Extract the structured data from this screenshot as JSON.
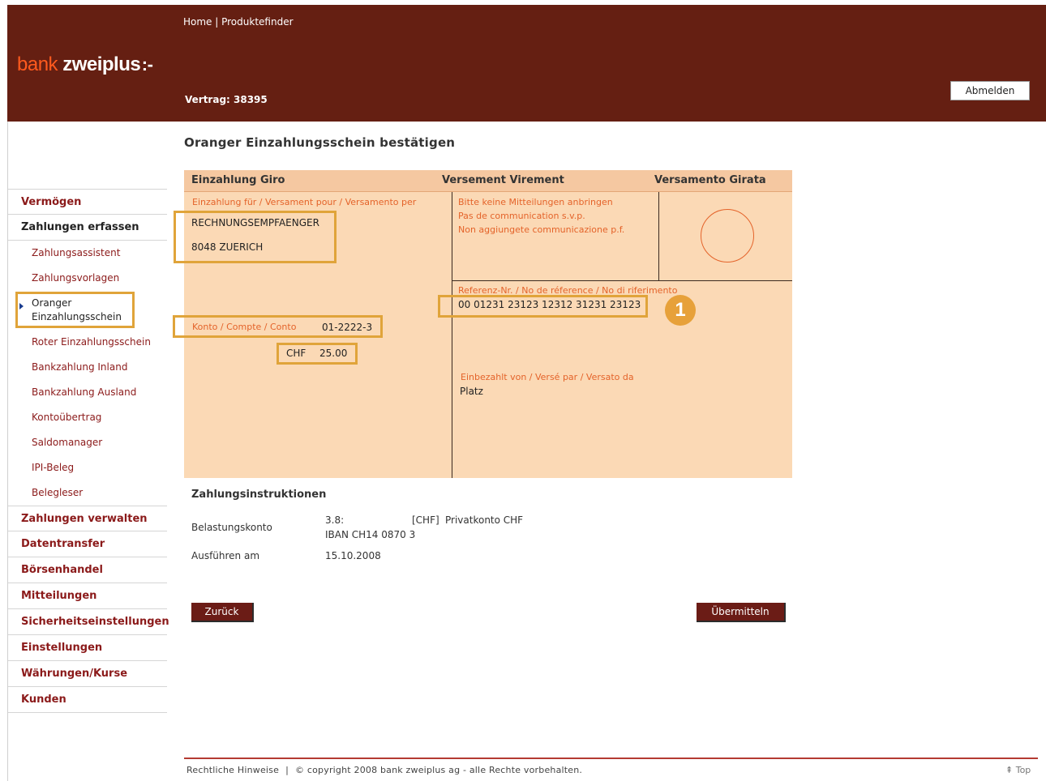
{
  "header": {
    "topnav_home": "Home",
    "topnav_sep": " | ",
    "topnav_finder": "Produktefinder",
    "logo_part1": "bank",
    "logo_part2": " zweiplus",
    "logo_mark": ":-",
    "contract": "Vertrag: 38395",
    "logout_label": "Abmelden"
  },
  "page_title": "Oranger Einzahlungsschein bestätigen",
  "sidebar": {
    "items": [
      {
        "label": "Vermögen"
      },
      {
        "label": "Zahlungen erfassen"
      },
      {
        "label": "Zahlungsassistent"
      },
      {
        "label": "Zahlungsvorlagen"
      },
      {
        "label_line1": "Oranger",
        "label_line2": "Einzahlungsschein"
      },
      {
        "label": "Roter Einzahlungsschein"
      },
      {
        "label": "Bankzahlung Inland"
      },
      {
        "label": "Bankzahlung Ausland"
      },
      {
        "label": "Kontoübertrag"
      },
      {
        "label": "Saldomanager"
      },
      {
        "label": "IPI-Beleg"
      },
      {
        "label": "Belegleser"
      },
      {
        "label": "Zahlungen verwalten"
      },
      {
        "label": "Datentransfer"
      },
      {
        "label": "Börsenhandel"
      },
      {
        "label": "Mitteilungen"
      },
      {
        "label": "Sicherheitseinstellungen"
      },
      {
        "label": "Einstellungen"
      },
      {
        "label": "Währungen/Kurse"
      },
      {
        "label": "Kunden"
      }
    ]
  },
  "slip": {
    "header_left": "Einzahlung Giro",
    "header_center": "Versement Virement",
    "header_right": "Versamento Girata",
    "for_label": "Einzahlung für / Versament pour / Versamento per",
    "recipient_name": "RECHNUNGSEMPFAENGER",
    "recipient_city": "8048 ZUERICH",
    "no_message_1": "Bitte keine Mitteilungen anbringen",
    "no_message_2": "Pas de communication s.v.p.",
    "no_message_3": "Non aggiungete communicazione p.f.",
    "reference_label": "Referenz-Nr. / No de réference / No di riferimento",
    "reference_value": "00 01231 23123 12312 31231 23123",
    "badge": "1",
    "account_label": "Konto / Compte / Conto",
    "account_value": "01-2222-3",
    "currency": "CHF",
    "amount": "25.00",
    "paid_by_label": "Einbezahlt von / Versé par / Versato da",
    "paid_by_value": "Platz"
  },
  "instructions": {
    "title": "Zahlungsinstruktionen",
    "debit_label": "Belastungskonto",
    "debit_account": "3.8:",
    "debit_currency": "[CHF]",
    "debit_name": "Privatkonto CHF",
    "debit_iban": "IBAN  CH14 0870 3",
    "execute_label": "Ausführen am",
    "execute_date": "15.10.2008"
  },
  "buttons": {
    "back": "Zurück",
    "submit": "Übermitteln"
  },
  "footer": {
    "legal": "Rechtliche Hinweise",
    "separator": "|",
    "copyright": "© copyright 2008 bank zweiplus ag - alle Rechte vorbehalten.",
    "top": "⇞ Top"
  },
  "colors": {
    "header_bg": "#651f12",
    "slip_bg": "#fbd9b5",
    "highlight": "#e0a43a",
    "accent_orange": "#e4632a",
    "nav_red": "#8b1a1a"
  }
}
